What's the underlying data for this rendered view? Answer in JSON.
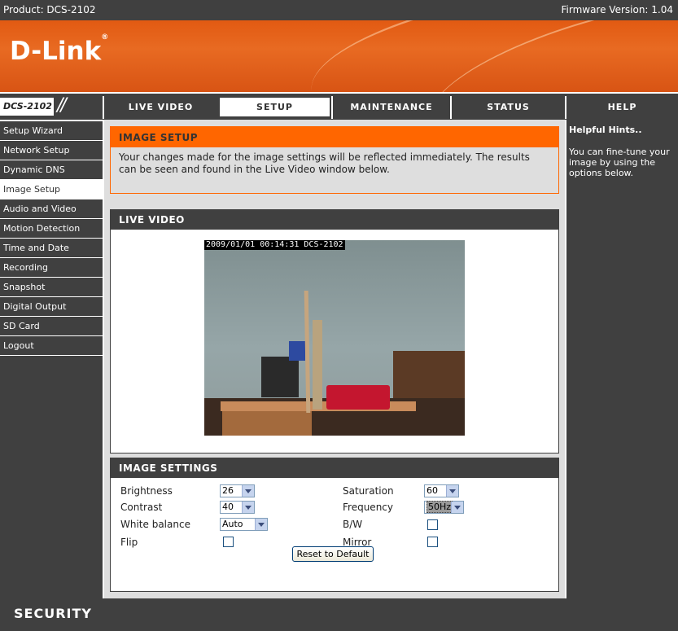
{
  "topbar": {
    "product": "Product: DCS-2102",
    "firmware": "Firmware Version: 1.04"
  },
  "banner": {
    "logo": "D-Link",
    "logo_mark": "®"
  },
  "nav": {
    "model": "DCS-2102",
    "tabs": [
      {
        "label": "LIVE VIDEO"
      },
      {
        "label": "SETUP"
      },
      {
        "label": "MAINTENANCE"
      },
      {
        "label": "STATUS"
      },
      {
        "label": "HELP"
      }
    ]
  },
  "sidebar": {
    "items": [
      {
        "label": "Setup Wizard"
      },
      {
        "label": "Network Setup"
      },
      {
        "label": "Dynamic DNS"
      },
      {
        "label": "Image Setup"
      },
      {
        "label": "Audio and Video"
      },
      {
        "label": "Motion Detection"
      },
      {
        "label": "Time and Date"
      },
      {
        "label": "Recording"
      },
      {
        "label": "Snapshot"
      },
      {
        "label": "Digital Output"
      },
      {
        "label": "SD Card"
      },
      {
        "label": "Logout"
      }
    ]
  },
  "image_setup": {
    "title": "IMAGE SETUP",
    "text": "Your changes made for the image settings will be reflected immediately. The results can be seen and found in the Live Video window below."
  },
  "live_video": {
    "title": "LIVE VIDEO",
    "timestamp": "2009/01/01 00:14:31 DCS-2102"
  },
  "image_settings": {
    "title": "IMAGE SETTINGS",
    "brightness": {
      "label": "Brightness",
      "value": "26"
    },
    "contrast": {
      "label": "Contrast",
      "value": "40"
    },
    "white_balance": {
      "label": "White balance",
      "value": "Auto"
    },
    "flip": {
      "label": "Flip",
      "checked": false
    },
    "saturation": {
      "label": "Saturation",
      "value": "60"
    },
    "frequency": {
      "label": "Frequency",
      "value": "50Hz"
    },
    "bw": {
      "label": "B/W",
      "checked": false
    },
    "mirror": {
      "label": "Mirror",
      "checked": false
    },
    "reset_label": "Reset to Default"
  },
  "help": {
    "title": "Helpful Hints..",
    "text": "You can fine-tune your image by using the options below."
  },
  "footer": {
    "label": "SECURITY"
  },
  "colors": {
    "accent": "#ff6600",
    "dark": "#404040"
  }
}
